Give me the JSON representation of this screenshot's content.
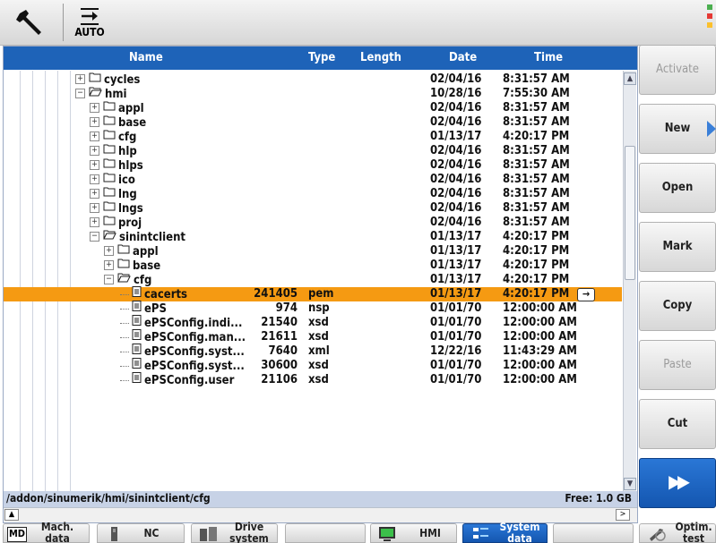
{
  "topbar": {
    "mode_label": "AUTO"
  },
  "columns": {
    "name": "Name",
    "type": "Type",
    "length": "Length",
    "date": "Date",
    "time": "Time"
  },
  "rows": [
    {
      "name": "cycles",
      "type": "",
      "length": "",
      "date": "02/04/16",
      "time": "8:31:57 AM",
      "level": 0,
      "kind": "folder",
      "expanded": false
    },
    {
      "name": "hmi",
      "type": "",
      "length": "",
      "date": "10/28/16",
      "time": "7:55:30 AM",
      "level": 0,
      "kind": "folder",
      "expanded": true
    },
    {
      "name": "appl",
      "type": "",
      "length": "",
      "date": "02/04/16",
      "time": "8:31:57 AM",
      "level": 1,
      "kind": "folder",
      "expanded": false
    },
    {
      "name": "base",
      "type": "",
      "length": "",
      "date": "02/04/16",
      "time": "8:31:57 AM",
      "level": 1,
      "kind": "folder",
      "expanded": false
    },
    {
      "name": "cfg",
      "type": "",
      "length": "",
      "date": "01/13/17",
      "time": "4:20:17 PM",
      "level": 1,
      "kind": "folder",
      "expanded": false
    },
    {
      "name": "hlp",
      "type": "",
      "length": "",
      "date": "02/04/16",
      "time": "8:31:57 AM",
      "level": 1,
      "kind": "folder",
      "expanded": false
    },
    {
      "name": "hlps",
      "type": "",
      "length": "",
      "date": "02/04/16",
      "time": "8:31:57 AM",
      "level": 1,
      "kind": "folder",
      "expanded": false
    },
    {
      "name": "ico",
      "type": "",
      "length": "",
      "date": "02/04/16",
      "time": "8:31:57 AM",
      "level": 1,
      "kind": "folder",
      "expanded": false
    },
    {
      "name": "lng",
      "type": "",
      "length": "",
      "date": "02/04/16",
      "time": "8:31:57 AM",
      "level": 1,
      "kind": "folder",
      "expanded": false
    },
    {
      "name": "lngs",
      "type": "",
      "length": "",
      "date": "02/04/16",
      "time": "8:31:57 AM",
      "level": 1,
      "kind": "folder",
      "expanded": false
    },
    {
      "name": "proj",
      "type": "",
      "length": "",
      "date": "02/04/16",
      "time": "8:31:57 AM",
      "level": 1,
      "kind": "folder",
      "expanded": false
    },
    {
      "name": "sinintclient",
      "type": "",
      "length": "",
      "date": "01/13/17",
      "time": "4:20:17 PM",
      "level": 1,
      "kind": "folder",
      "expanded": true
    },
    {
      "name": "appl",
      "type": "",
      "length": "",
      "date": "01/13/17",
      "time": "4:20:17 PM",
      "level": 2,
      "kind": "folder",
      "expanded": false
    },
    {
      "name": "base",
      "type": "",
      "length": "",
      "date": "01/13/17",
      "time": "4:20:17 PM",
      "level": 2,
      "kind": "folder",
      "expanded": false
    },
    {
      "name": "cfg",
      "type": "",
      "length": "",
      "date": "01/13/17",
      "time": "4:20:17 PM",
      "level": 2,
      "kind": "folder",
      "expanded": true
    },
    {
      "name": "cacerts",
      "type": "pem",
      "length": "241405",
      "date": "01/13/17",
      "time": "4:20:17 PM",
      "level": 3,
      "kind": "file",
      "selected": true
    },
    {
      "name": "ePS",
      "type": "nsp",
      "length": "974",
      "date": "01/01/70",
      "time": "12:00:00 AM",
      "level": 3,
      "kind": "file"
    },
    {
      "name": "ePSConfig.indi...",
      "type": "xsd",
      "length": "21540",
      "date": "01/01/70",
      "time": "12:00:00 AM",
      "level": 3,
      "kind": "file"
    },
    {
      "name": "ePSConfig.man...",
      "type": "xsd",
      "length": "21611",
      "date": "01/01/70",
      "time": "12:00:00 AM",
      "level": 3,
      "kind": "file"
    },
    {
      "name": "ePSConfig.syst...",
      "type": "xml",
      "length": "7640",
      "date": "12/22/16",
      "time": "11:43:29 AM",
      "level": 3,
      "kind": "file"
    },
    {
      "name": "ePSConfig.syst...",
      "type": "xsd",
      "length": "30600",
      "date": "01/01/70",
      "time": "12:00:00 AM",
      "level": 3,
      "kind": "file"
    },
    {
      "name": "ePSConfig.user",
      "type": "xsd",
      "length": "21106",
      "date": "01/01/70",
      "time": "12:00:00 AM",
      "level": 3,
      "kind": "file"
    }
  ],
  "pathbar": {
    "path": "/addon/sinumerik/hmi/sinintclient/cfg",
    "free": "Free: 1.0 GB"
  },
  "softkeys_right": {
    "activate": "Activate",
    "new": "New",
    "open": "Open",
    "mark": "Mark",
    "copy": "Copy",
    "paste": "Paste",
    "cut": "Cut",
    "next": "▶▶"
  },
  "softkeys_bottom": {
    "md_badge": "MD",
    "mach_data_1": "Mach.",
    "mach_data_2": "data",
    "nc": "NC",
    "drive_1": "Drive",
    "drive_2": "system",
    "hmi": "HMI",
    "system_1": "System",
    "system_2": "data",
    "optim_1": "Optim.",
    "optim_2": "test"
  },
  "colors": {
    "header": "#1e63b8",
    "selection": "#f59a12",
    "pathbar": "#c7d2e6",
    "accent": "#3a7fd8"
  }
}
